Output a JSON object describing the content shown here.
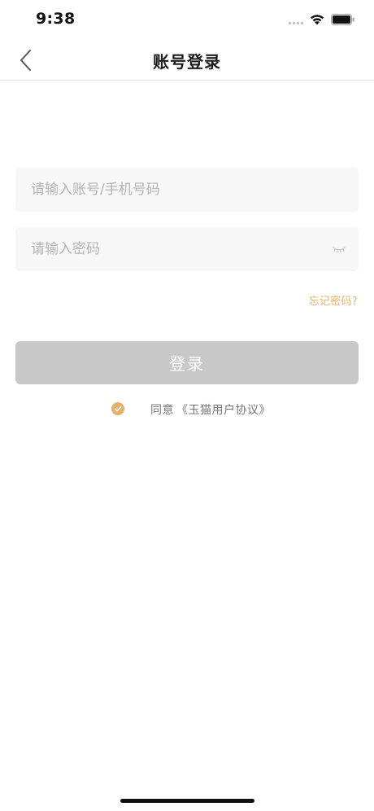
{
  "status_bar": {
    "time": "9:38"
  },
  "nav": {
    "title": "账号登录"
  },
  "form": {
    "account_placeholder": "请输入账号/手机号码",
    "password_placeholder": "请输入密码",
    "forgot_label": "忘记密码?",
    "login_label": "登录",
    "agree_label": "同意",
    "agreement_link": "《玉猫用户协议》"
  },
  "colors": {
    "accent": "#e4b06b",
    "button_disabled": "#c8c8c8",
    "field_bg": "#f7f7f7"
  },
  "icons": [
    "back-chevron",
    "wifi",
    "battery",
    "eye-closed",
    "check-circle"
  ]
}
